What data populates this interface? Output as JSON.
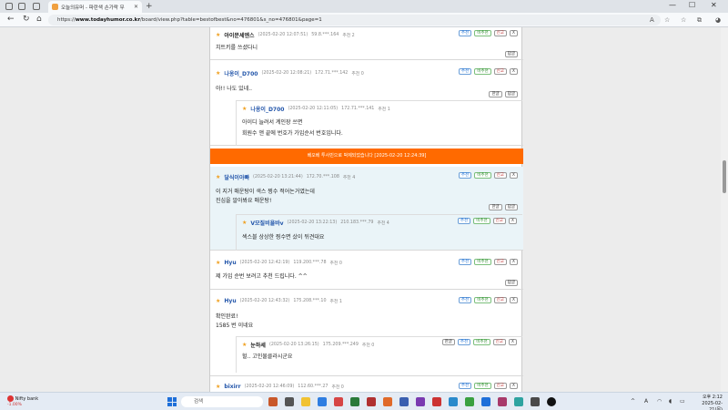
{
  "browser": {
    "tab_title": "오늘의유머 - 파란색 손가락 무",
    "url_prefix": "https://",
    "url_host": "www.todayhumor.co.kr",
    "url_path": "/board/view.php?table=bestofbest&no=476801&s_no=476801&page=1"
  },
  "buttons": {
    "up": "추천",
    "down": "비추천",
    "report": "신고",
    "close": "X",
    "reply": "답글",
    "lang_choice": "한글"
  },
  "comments": [
    {
      "nick": "아이문세엔스",
      "date": "(2025-02-20 12:07:51)",
      "ip": "59.8.***.164",
      "rec": "추천 2",
      "text": "치트키를 쓰셨다니"
    },
    {
      "nick": "나옹이_D700",
      "date": "(2025-02-20 12:08:21)",
      "ip": "172.71.***.142",
      "rec": "추천 0",
      "text": "아!! 나도 있네.."
    },
    {
      "nick": "나옹이_D700",
      "date": "(2025-02-20 12:11:05)",
      "ip": "172.71.***.141",
      "rec": "추천 1",
      "line1": "아이디 늘려서 계인장 쓰면",
      "line2": "회원수 앤 끝에 번호가 가입순서 번호입니다."
    },
    {
      "nick": "달식이아빠",
      "date": "(2025-02-20 13:21:44)",
      "ip": "172.70.***.108",
      "rec": "추천 4",
      "line1": "이 지거 매운탕이 색스 찡수 적어논거였는데",
      "line2": "진심을 알아봐요 매운탕!"
    },
    {
      "nick": "V모질비욜바v",
      "date": "(2025-02-20 13:22:13)",
      "ip": "210.183.***.79",
      "rec": "추천 4",
      "text": "섹스블 상상한 찡수면 샀이 뒤견대요"
    },
    {
      "nick": "Hyu",
      "date": "(2025-02-20 12:42:19)",
      "ip": "119.200.***.78",
      "rec": "추천 0",
      "text": "제 가입 순번 보려고 추천 드립니다. ^^"
    },
    {
      "nick": "Hyu",
      "date": "(2025-02-20 12:43:32)",
      "ip": "175.208.***.10",
      "rec": "추천 1",
      "line1": "확인완료!",
      "line2": "1585 번 이네요"
    },
    {
      "nick": "눈하세",
      "date": "(2025-02-20 13:26:15)",
      "ip": "175.209.***.249",
      "rec": "추천 0",
      "text": "헐.. 고인물클라시군요"
    },
    {
      "nick": "bixirr",
      "date": "(2025-02-20 12:46:09)",
      "ip": "112.60.***.27",
      "rec": "추천 0"
    }
  ],
  "banner": {
    "text": "베오베 투사빈으로 박제되었습니다 [2025-02-20 12:24:39]"
  },
  "taskbar": {
    "weather_title": "Nifty bank",
    "weather_change": "-1.00%",
    "search": "검색",
    "lang": "A",
    "time": "오후 2:12",
    "date": "2025-02-21(목)"
  },
  "colors": {
    "banner": "#ff6a00",
    "highlight": "#eaf4f8"
  }
}
